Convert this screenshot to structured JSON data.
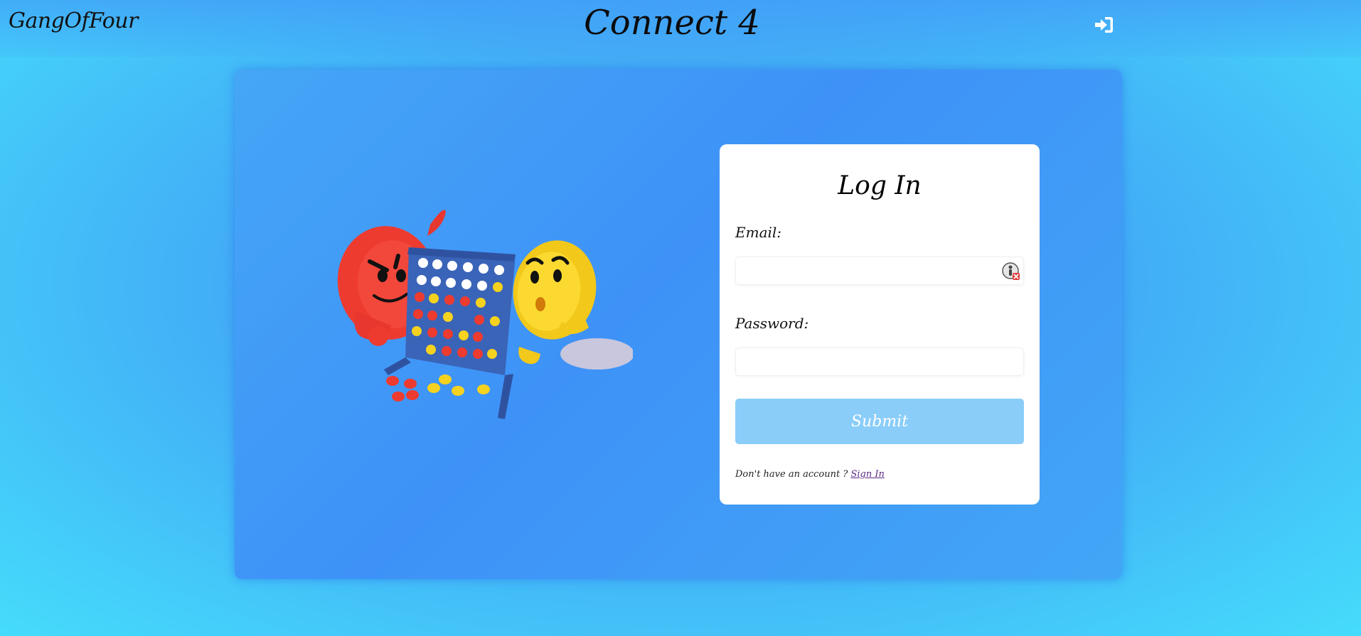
{
  "header": {
    "brand": "GangOfFour",
    "title": "Connect 4",
    "login_icon": "sign-in-icon"
  },
  "illustration": {
    "icon": "connect-four-mascots-illustration"
  },
  "login_form": {
    "title": "Log In",
    "email_label": "Email:",
    "email_value": "",
    "password_label": "Password:",
    "password_value": "",
    "submit_label": "Submit",
    "signup_prompt": "Don't have an account ?",
    "signup_link": "Sign In",
    "password_manager_icon": "password-manager-icon"
  },
  "colors": {
    "background": "#45dcfb",
    "card": "#3e92f7",
    "submit": "#8acdf9",
    "link": "#5b2a86"
  }
}
